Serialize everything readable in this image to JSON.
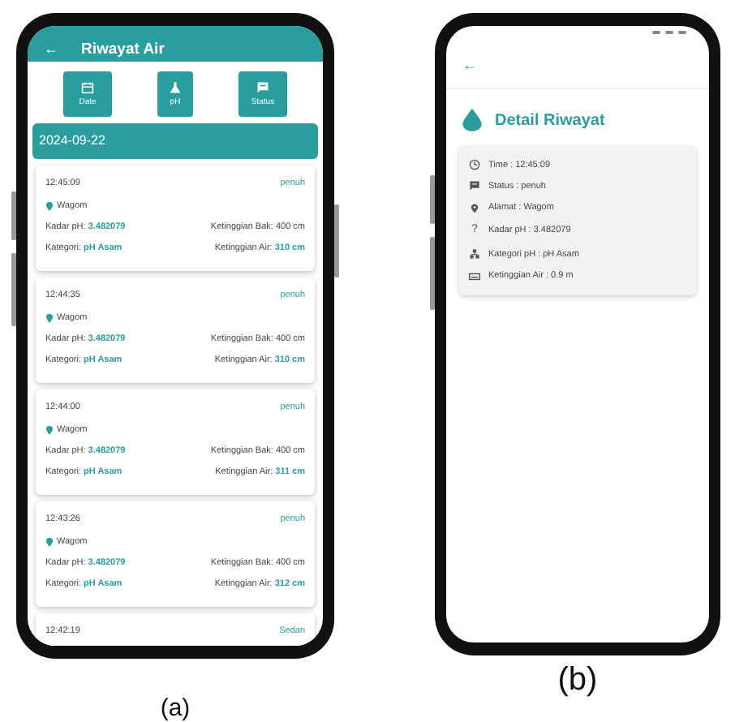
{
  "history_screen": {
    "caption": "(a)",
    "back": "←",
    "title": "Riwayat Air",
    "filters": [
      {
        "kind": "calendar",
        "label": "Date"
      },
      {
        "kind": "flask",
        "label": "pH"
      },
      {
        "kind": "message",
        "label": "Status"
      }
    ],
    "date": "2024-09-22",
    "records": [
      {
        "time": "12:45:09",
        "status": "penuh",
        "location": "Wagom",
        "ph_label": "Kadar pH:",
        "ph": "3.482079",
        "tank": "Ketinggian Bak: 400 cm",
        "category_label": "Kategori:",
        "category": "pH Asam",
        "water_label": "Ketinggian Air:",
        "water": "310 cm"
      },
      {
        "time": "12:44:35",
        "status": "penuh",
        "location": "Wagom",
        "ph_label": "Kadar pH:",
        "ph": "3.482079",
        "tank": "Ketinggian Bak: 400 cm",
        "category_label": "Kategori:",
        "category": "pH Asam",
        "water_label": "Ketinggian Air:",
        "water": "310 cm"
      },
      {
        "time": "12:44:00",
        "status": "penuh",
        "location": "Wagom",
        "ph_label": "Kadar pH:",
        "ph": "3.482079",
        "tank": "Ketinggian Bak: 400 cm",
        "category_label": "Kategori:",
        "category": "pH Asam",
        "water_label": "Ketinggian Air:",
        "water": "311 cm"
      },
      {
        "time": "12:43:26",
        "status": "penuh",
        "location": "Wagom",
        "ph_label": "Kadar pH:",
        "ph": "3.482079",
        "tank": "Ketinggian Bak: 400 cm",
        "category_label": "Kategori:",
        "category": "pH Asam",
        "water_label": "Ketinggian Air:",
        "water": "312 cm"
      },
      {
        "time": "12:42:19",
        "status": "Sedan"
      }
    ]
  },
  "detail_screen": {
    "caption": "(b)",
    "back": "←",
    "title": "Detail Riwayat",
    "fields": [
      {
        "kind": "clock",
        "text": "Time : 12:45:09"
      },
      {
        "kind": "message",
        "text": "Status : penuh"
      },
      {
        "kind": "pin",
        "text": "Alamat : Wagom"
      },
      {
        "kind": "glyph",
        "glyph": "?",
        "text": "Kadar pH : 3.482079"
      },
      {
        "kind": "hierarchy",
        "text": "Kategori pH : pH Asam"
      },
      {
        "kind": "keyboard",
        "text": "Ketinggian  Air : 0.9 m"
      }
    ]
  }
}
